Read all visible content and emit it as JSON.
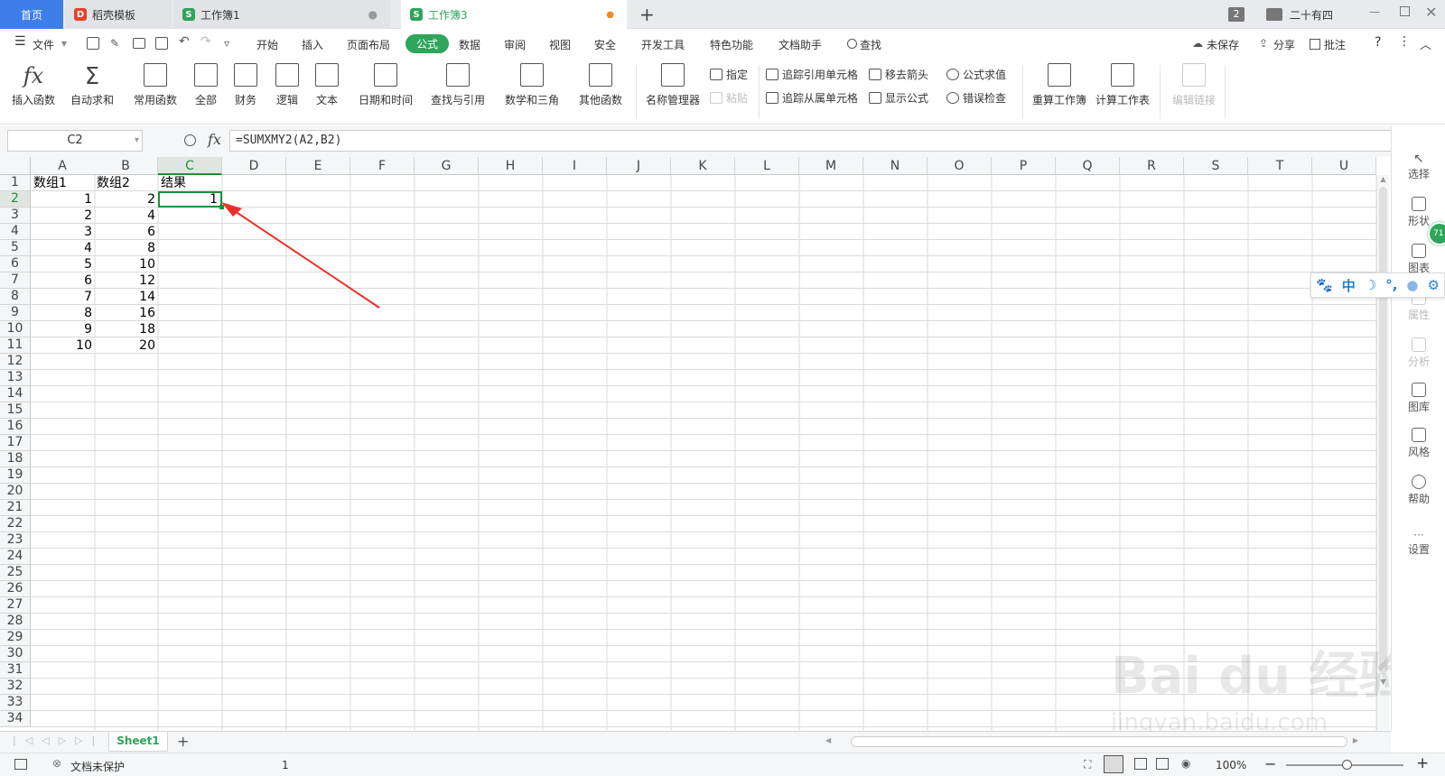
{
  "tabs": [
    {
      "label": "首页"
    },
    {
      "label": "稻壳模板"
    },
    {
      "label": "工作簿1"
    },
    {
      "label": "工作簿3"
    }
  ],
  "window": {
    "badge": "2",
    "user": "二十有四"
  },
  "menu": {
    "file": "文件",
    "items": [
      "开始",
      "插入",
      "页面布局",
      "公式",
      "数据",
      "审阅",
      "视图",
      "安全",
      "开发工具",
      "特色功能",
      "文档助手"
    ],
    "search": "查找",
    "right": [
      "未保存",
      "分享",
      "批注"
    ]
  },
  "ribbon": {
    "insert_fn": "插入函数",
    "autosum": "自动求和",
    "common": "常用函数",
    "all": "全部",
    "finance": "财务",
    "logic": "逻辑",
    "text": "文本",
    "datetime": "日期和时间",
    "lookup": "查找与引用",
    "math": "数学和三角",
    "other": "其他函数",
    "name_mgr": "名称管理器",
    "define": "指定",
    "paste": "粘贴",
    "trace_prec": "追踪引用单元格",
    "trace_dep": "追踪从属单元格",
    "remove_arrows": "移去箭头",
    "show_formula": "显示公式",
    "eval_formula": "公式求值",
    "error_check": "错误检查",
    "recalc_book": "重算工作簿",
    "calc_sheet": "计算工作表",
    "edit_links": "编辑链接",
    "icon_fx": "fx",
    "icon_sigma": "Σ"
  },
  "formula_bar": {
    "name_box": "C2",
    "fx": "fx",
    "formula": "=SUMXMY2(A2,B2)"
  },
  "columns": [
    "A",
    "B",
    "C",
    "D",
    "E",
    "F",
    "G",
    "H",
    "I",
    "J",
    "K",
    "L",
    "M",
    "N",
    "O",
    "P",
    "Q",
    "R",
    "S",
    "T",
    "U"
  ],
  "rows": [
    "1",
    "2",
    "3",
    "4",
    "5",
    "6",
    "7",
    "8",
    "9",
    "10",
    "11",
    "12",
    "13",
    "14",
    "15",
    "16",
    "17",
    "18",
    "19",
    "20",
    "21",
    "22",
    "23",
    "24",
    "25",
    "26",
    "27",
    "28",
    "29",
    "30",
    "31",
    "32",
    "33",
    "34"
  ],
  "cells": {
    "headers": [
      "数组1",
      "数组2",
      "结果"
    ],
    "colA": [
      "1",
      "2",
      "3",
      "4",
      "5",
      "6",
      "7",
      "8",
      "9",
      "10"
    ],
    "colB": [
      "2",
      "4",
      "6",
      "8",
      "10",
      "12",
      "14",
      "16",
      "18",
      "20"
    ],
    "C2": "1"
  },
  "sidebar": [
    "选择",
    "形状",
    "图表",
    "属性",
    "分析",
    "图库",
    "风格",
    "帮助",
    "设置"
  ],
  "ime": {
    "zh": "中",
    "badge": "71"
  },
  "sheet": {
    "name": "Sheet1"
  },
  "status": {
    "protect": "文档未保护",
    "value": "1",
    "zoom": "100%"
  },
  "watermark": {
    "brand": "Bai du 经验",
    "url": "jingyan.baidu.com"
  },
  "colors": {
    "accent": "#2ea55a",
    "selection": "#1f8f3a",
    "arrow": "#e8322b"
  }
}
